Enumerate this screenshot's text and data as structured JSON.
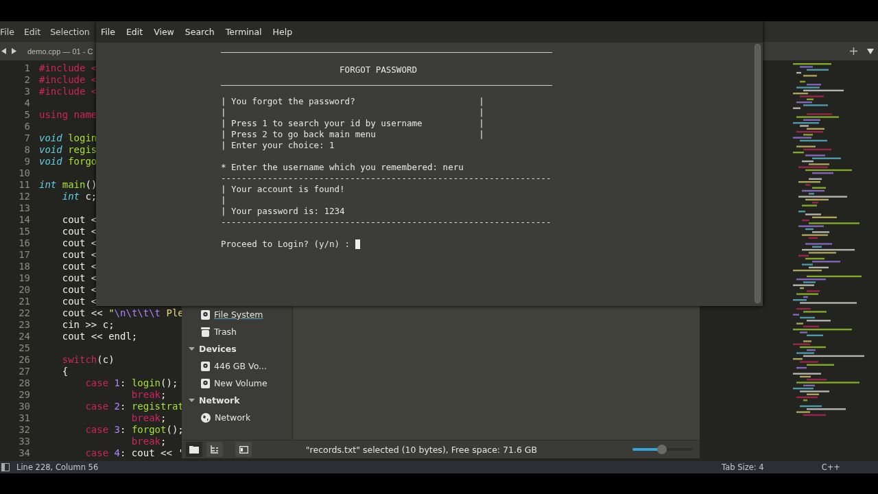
{
  "editor": {
    "menu": [
      "File",
      "Edit",
      "Selection"
    ],
    "tab_title": "demo.cpp — 01 - C",
    "lines": [
      {
        "number": "1",
        "tokens": [
          {
            "kind": "preproc",
            "text": "#include <"
          }
        ]
      },
      {
        "number": "2",
        "tokens": [
          {
            "kind": "preproc",
            "text": "#include <"
          }
        ]
      },
      {
        "number": "3",
        "tokens": [
          {
            "kind": "preproc",
            "text": "#include <"
          }
        ]
      },
      {
        "number": "4"
      },
      {
        "number": "5",
        "tokens": [
          {
            "kind": "keyword",
            "text": "using name"
          }
        ]
      },
      {
        "number": "6"
      },
      {
        "number": "7",
        "tokens": [
          {
            "kind": "type",
            "text": "void"
          },
          {
            "kind": "func",
            "text": " login"
          }
        ]
      },
      {
        "number": "8",
        "tokens": [
          {
            "kind": "type",
            "text": "void"
          },
          {
            "kind": "func",
            "text": " regis"
          }
        ]
      },
      {
        "number": "9",
        "tokens": [
          {
            "kind": "type",
            "text": "void"
          },
          {
            "kind": "func",
            "text": " forgo"
          }
        ]
      },
      {
        "number": "10"
      },
      {
        "number": "11",
        "tokens": [
          {
            "kind": "type",
            "text": "int"
          },
          {
            "kind": "func",
            "text": " main"
          },
          {
            "kind": "plain",
            "text": "()"
          }
        ]
      },
      {
        "number": "12",
        "tokens": [
          {
            "kind": "type",
            "text": "    int"
          },
          {
            "kind": "plain",
            "text": " c;"
          }
        ]
      },
      {
        "number": "13"
      },
      {
        "number": "14",
        "tokens": [
          {
            "kind": "plain",
            "text": "    cout <"
          }
        ]
      },
      {
        "number": "15",
        "tokens": [
          {
            "kind": "plain",
            "text": "    cout <"
          }
        ]
      },
      {
        "number": "16",
        "tokens": [
          {
            "kind": "plain",
            "text": "    cout <"
          }
        ]
      },
      {
        "number": "17",
        "tokens": [
          {
            "kind": "plain",
            "text": "    cout <"
          }
        ]
      },
      {
        "number": "18",
        "tokens": [
          {
            "kind": "plain",
            "text": "    cout <"
          }
        ]
      },
      {
        "number": "19",
        "tokens": [
          {
            "kind": "plain",
            "text": "    cout <"
          }
        ]
      },
      {
        "number": "20",
        "tokens": [
          {
            "kind": "plain",
            "text": "    cout <"
          }
        ]
      },
      {
        "number": "21",
        "tokens": [
          {
            "kind": "plain",
            "text": "    cout <"
          }
        ]
      },
      {
        "number": "22",
        "tokens": [
          {
            "kind": "plain",
            "text": "    cout << "
          },
          {
            "kind": "string",
            "text": "\""
          },
          {
            "kind": "escape",
            "text": "\\n\\t\\t\\t"
          },
          {
            "kind": "string",
            "text": " Ple"
          }
        ]
      },
      {
        "number": "23",
        "tokens": [
          {
            "kind": "plain",
            "text": "    cin >> c;"
          }
        ]
      },
      {
        "number": "24",
        "tokens": [
          {
            "kind": "plain",
            "text": "    cout << endl;"
          }
        ]
      },
      {
        "number": "25"
      },
      {
        "number": "26",
        "tokens": [
          {
            "kind": "keyword",
            "text": "    switch"
          },
          {
            "kind": "plain",
            "text": "(c)"
          }
        ]
      },
      {
        "number": "27",
        "tokens": [
          {
            "kind": "plain",
            "text": "    {"
          }
        ]
      },
      {
        "number": "28",
        "tokens": [
          {
            "kind": "keyword",
            "text": "        case"
          },
          {
            "kind": "number",
            "text": " 1"
          },
          {
            "kind": "plain",
            "text": ": "
          },
          {
            "kind": "func",
            "text": "login"
          },
          {
            "kind": "plain",
            "text": "();"
          }
        ]
      },
      {
        "number": "29",
        "tokens": [
          {
            "kind": "keyword",
            "text": "                break"
          },
          {
            "kind": "plain",
            "text": ";"
          }
        ]
      },
      {
        "number": "30",
        "tokens": [
          {
            "kind": "keyword",
            "text": "        case"
          },
          {
            "kind": "number",
            "text": " 2"
          },
          {
            "kind": "plain",
            "text": ": "
          },
          {
            "kind": "func",
            "text": "registrat"
          }
        ]
      },
      {
        "number": "31",
        "tokens": [
          {
            "kind": "keyword",
            "text": "                break"
          },
          {
            "kind": "plain",
            "text": ";"
          }
        ]
      },
      {
        "number": "32",
        "tokens": [
          {
            "kind": "keyword",
            "text": "        case"
          },
          {
            "kind": "number",
            "text": " 3"
          },
          {
            "kind": "plain",
            "text": ": "
          },
          {
            "kind": "func",
            "text": "forgot"
          },
          {
            "kind": "plain",
            "text": "();"
          }
        ]
      },
      {
        "number": "33",
        "tokens": [
          {
            "kind": "keyword",
            "text": "                break"
          },
          {
            "kind": "plain",
            "text": ";"
          }
        ]
      },
      {
        "number": "34",
        "tokens": [
          {
            "kind": "keyword",
            "text": "        case"
          },
          {
            "kind": "number",
            "text": " 4"
          },
          {
            "kind": "plain",
            "text": ": cout << '"
          }
        ]
      }
    ],
    "status_bar": {
      "position": "Line 228, Column 56",
      "tab_size": "Tab Size: 4",
      "syntax": "C++"
    }
  },
  "terminal": {
    "menu": [
      "File",
      "Edit",
      "View",
      "Search",
      "Terminal",
      "Help"
    ],
    "lines": [
      {
        "kind": "rule"
      },
      {
        "kind": "title",
        "text": "FORGOT PASSWORD"
      },
      {
        "kind": "rule"
      },
      {
        "kind": "text",
        "text": "| You forgot the password?                        |"
      },
      {
        "kind": "text",
        "text": "|                                                 |"
      },
      {
        "kind": "text",
        "text": "| Press 1 to search your id by username           |"
      },
      {
        "kind": "text",
        "text": "| Press 2 to go back main menu                    |"
      },
      {
        "kind": "text",
        "text": "| Enter your choice: 1"
      },
      {
        "kind": "blank"
      },
      {
        "kind": "text",
        "text": "* Enter the username which you remembered: neru"
      },
      {
        "kind": "text",
        "text": "----------------------------------------------------------------"
      },
      {
        "kind": "text",
        "text": "| Your account is found!"
      },
      {
        "kind": "text",
        "text": "|"
      },
      {
        "kind": "text",
        "text": "| Your password is: 1234"
      },
      {
        "kind": "text",
        "text": "----------------------------------------------------------------"
      },
      {
        "kind": "blank"
      },
      {
        "kind": "prompt",
        "text": "Proceed to Login? (y/n) :"
      }
    ]
  },
  "file_manager": {
    "sidebar": [
      {
        "items": [
          {
            "label": "File System",
            "kind": "drive",
            "hovered": true
          },
          {
            "label": "Trash",
            "kind": "trash",
            "hovered": false
          }
        ]
      },
      {
        "title": "Devices",
        "expanded": true,
        "items": [
          {
            "label": "446 GB Vo...",
            "kind": "drive",
            "hovered": false
          },
          {
            "label": "New Volume",
            "kind": "drive",
            "hovered": false
          }
        ]
      },
      {
        "title": "Network",
        "expanded": true,
        "items": [
          {
            "label": "Network",
            "kind": "globe",
            "hovered": false
          }
        ]
      }
    ],
    "view_buttons": [
      {
        "kind": "places",
        "selected": true
      },
      {
        "kind": "tree",
        "selected": false
      },
      {
        "kind": "panel",
        "selected": false
      }
    ],
    "status": "\"records.txt\" selected (10 bytes), Free space: 71.6 GB",
    "zoom": {
      "level": 0.49
    }
  }
}
